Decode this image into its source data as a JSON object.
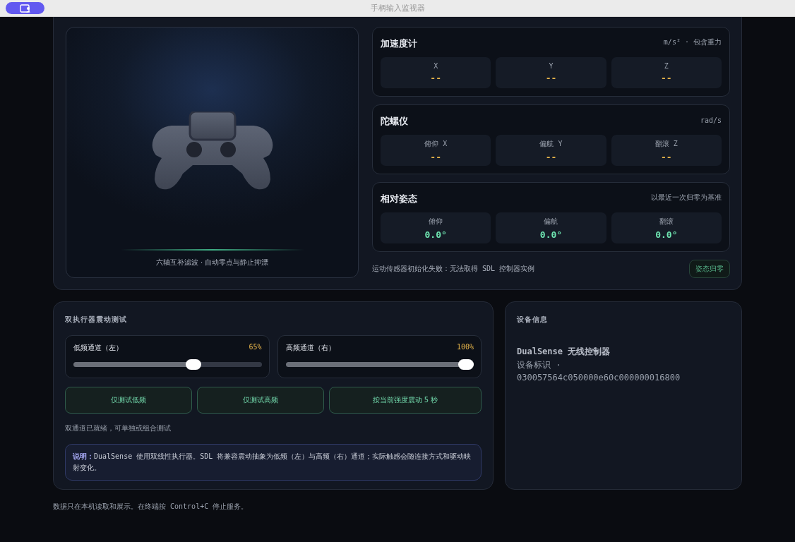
{
  "window": {
    "title": "手柄输入监视器"
  },
  "visual": {
    "caption": "六轴互补滤波 · 自动零点与静止抑漂"
  },
  "sensors": [
    {
      "title": "加速度计",
      "unit": "m/s² · 包含重力",
      "kind": "raw",
      "axes": [
        {
          "label": "X",
          "value": "--"
        },
        {
          "label": "Y",
          "value": "--"
        },
        {
          "label": "Z",
          "value": "--"
        }
      ]
    },
    {
      "title": "陀螺仪",
      "unit": "rad/s",
      "kind": "raw",
      "axes": [
        {
          "label": "俯仰 X",
          "value": "--"
        },
        {
          "label": "偏航 Y",
          "value": "--"
        },
        {
          "label": "翻滚 Z",
          "value": "--"
        }
      ]
    },
    {
      "title": "相对姿态",
      "unit": "以最近一次归零为基准",
      "kind": "attitude",
      "axes": [
        {
          "label": "俯仰",
          "value": "0.0°"
        },
        {
          "label": "偏航",
          "value": "0.0°"
        },
        {
          "label": "翻滚",
          "value": "0.0°"
        }
      ]
    }
  ],
  "motion_status": "运动传感器初始化失败：无法取得 SDL 控制器实例",
  "reset_button": "姿态归零",
  "rumble": {
    "title": "双执行器震动测试",
    "channels": [
      {
        "name": "低频通道（左）",
        "reading": "65%",
        "level": 0.65
      },
      {
        "name": "高频通道（右）",
        "reading": "100%",
        "level": 1
      }
    ],
    "buttons": [
      "仅测试低频",
      "仅测试高频",
      "按当前强度震动 5 秒"
    ],
    "status": "双通道已就绪，可单独或组合测试",
    "note": {
      "label": "说明：",
      "text": "DualSense 使用双线性执行器。SDL 将兼容震动抽象为低频（左）与高频（右）通道；实际触感会随连接方式和驱动映射变化。"
    }
  },
  "device": {
    "title": "设备信息",
    "name": "DualSense 无线控制器",
    "id_label": "设备标识 ·",
    "id": "030057564c050000e60c000000016800"
  },
  "footer": "数据只在本机读取和展示。在终端按 Control+C 停止服务。"
}
